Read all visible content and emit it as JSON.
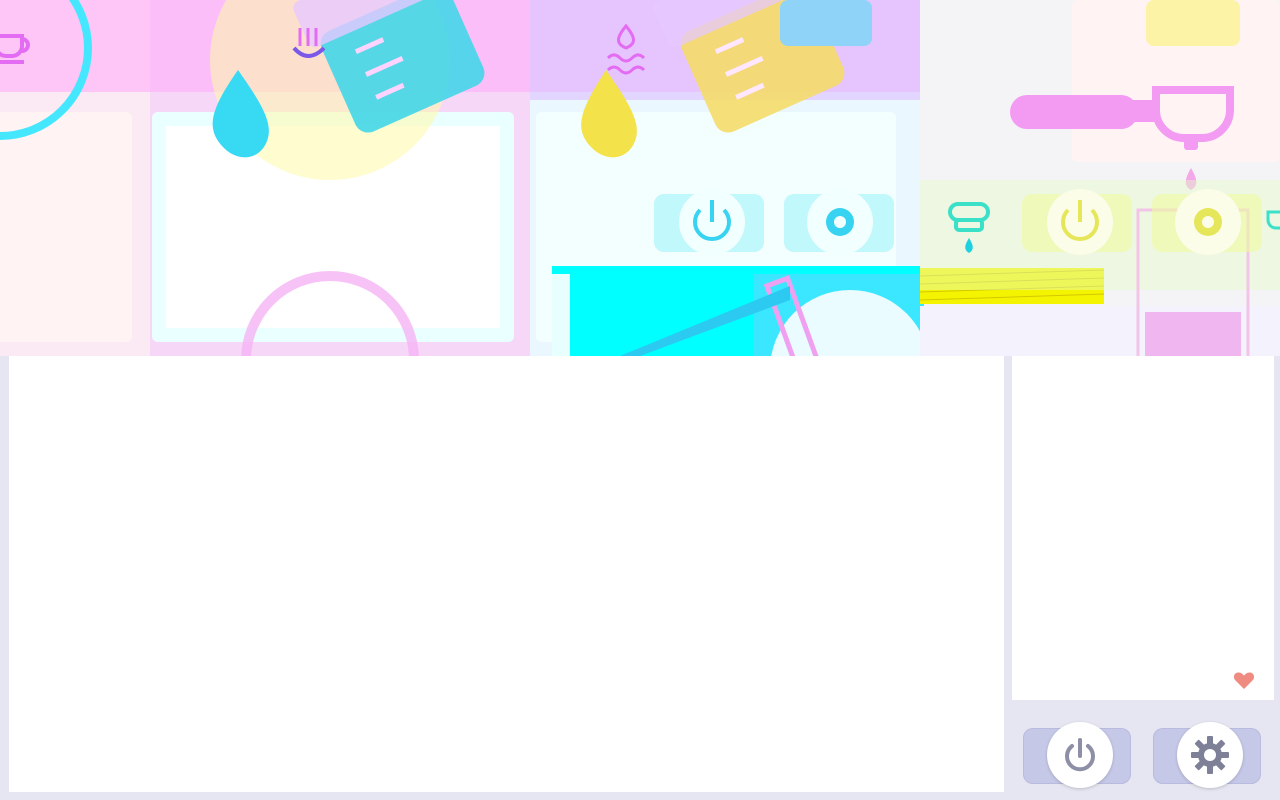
{
  "colors": {
    "page_background": "#e6e6f2",
    "panel_white": "#ffffff",
    "control_pill": "#c6c8e8",
    "icon_gray": "#8d8fa6",
    "heart": "#ef8b80",
    "neon_cyan": "#00ffff",
    "neon_pink": "#f7a6f7",
    "neon_yellow": "#f2f26a",
    "magenta_accent": "#e36cf2"
  },
  "controls": {
    "power_icon": "power-icon",
    "settings_icon": "gear-icon",
    "favorite_icon": "heart-icon"
  },
  "decorations": {
    "cup_icon": "coffee-cup-icon",
    "water_drop_icon": "water-drop-icon",
    "steam_icon": "steam-icon",
    "pitcher_icon": "measuring-pitcher-icon",
    "portafilter_icon": "portafilter-icon",
    "drip_icon": "drip-icon"
  }
}
